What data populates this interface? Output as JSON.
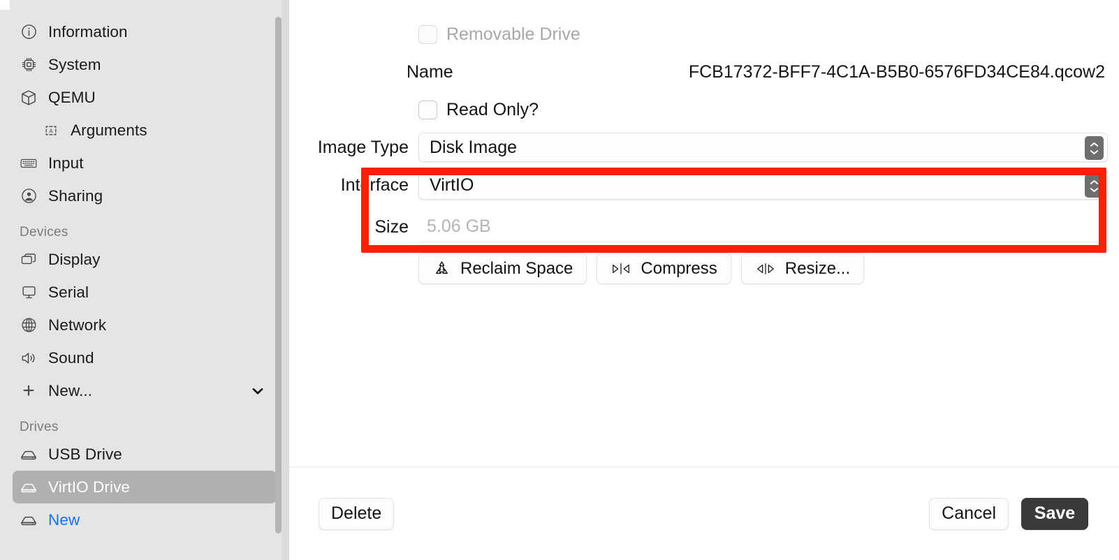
{
  "sidebar": {
    "items": [
      {
        "label": "Information",
        "icon": "info-circle-icon",
        "selected": false,
        "indent": false
      },
      {
        "label": "System",
        "icon": "cpu-chip-icon",
        "selected": false,
        "indent": false
      },
      {
        "label": "QEMU",
        "icon": "cube-box-icon",
        "selected": false,
        "indent": false
      },
      {
        "label": "Arguments",
        "icon": "text-box-a-icon",
        "selected": false,
        "indent": true
      },
      {
        "label": "Input",
        "icon": "keyboard-icon",
        "selected": false,
        "indent": false
      },
      {
        "label": "Sharing",
        "icon": "person-circle-icon",
        "selected": false,
        "indent": false
      }
    ],
    "devices_header": "Devices",
    "devices": [
      {
        "label": "Display",
        "icon": "display-windows-icon",
        "selected": false
      },
      {
        "label": "Serial",
        "icon": "monitor-serial-icon",
        "selected": false
      },
      {
        "label": "Network",
        "icon": "globe-network-icon",
        "selected": false
      },
      {
        "label": "Sound",
        "icon": "speaker-sound-icon",
        "selected": false
      }
    ],
    "new_device": {
      "label": "New...",
      "icon": "plus-icon",
      "chevron": "chevron-down-icon"
    },
    "drives_header": "Drives",
    "drives": [
      {
        "label": "USB Drive",
        "icon": "drive-icon",
        "selected": false,
        "blue": false
      },
      {
        "label": "VirtIO Drive",
        "icon": "drive-icon",
        "selected": true,
        "blue": false
      },
      {
        "label": "New",
        "icon": "drive-icon",
        "selected": false,
        "blue": true
      }
    ]
  },
  "main": {
    "removable_drive": {
      "label": "Removable Drive",
      "checked": false,
      "disabled": true
    },
    "name": {
      "label": "Name",
      "value": "FCB17372-BFF7-4C1A-B5B0-6576FD34CE84.qcow2"
    },
    "read_only": {
      "label": "Read Only?",
      "checked": false
    },
    "image_type": {
      "label": "Image Type",
      "value": "Disk Image"
    },
    "interface": {
      "label": "Interface",
      "value": "VirtIO"
    },
    "size": {
      "label": "Size",
      "placeholder": "5.06 GB",
      "value": ""
    },
    "actions": [
      {
        "label": "Reclaim Space",
        "icon": "recycle-icon"
      },
      {
        "label": "Compress",
        "icon": "compress-inward-icon"
      },
      {
        "label": "Resize...",
        "icon": "expand-outward-icon"
      }
    ],
    "highlight_color": "#FB2008"
  },
  "footer": {
    "delete_label": "Delete",
    "cancel_label": "Cancel",
    "save_label": "Save"
  }
}
